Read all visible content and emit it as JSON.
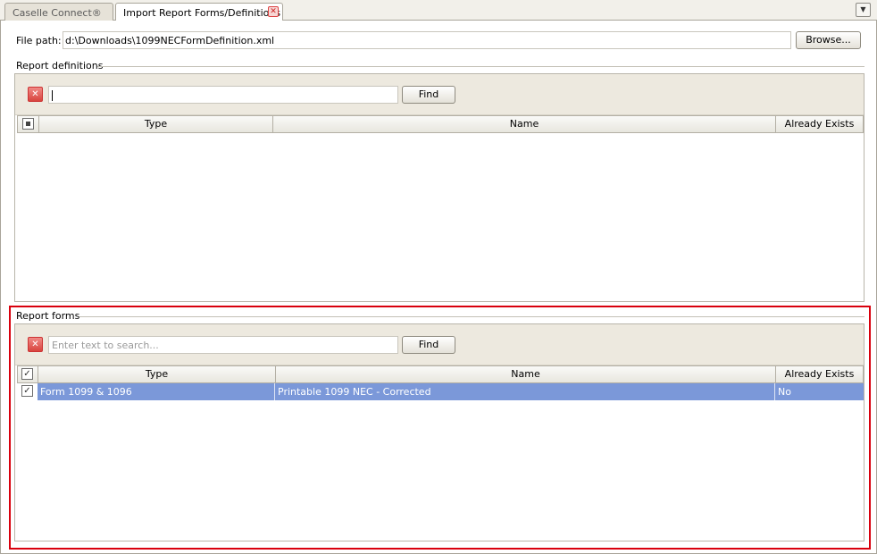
{
  "tabs": [
    {
      "label": "Caselle Connect®"
    },
    {
      "label": "Import Report Forms/Definitions"
    }
  ],
  "file_path": {
    "label": "File path:",
    "value": "d:\\Downloads\\1099NECFormDefinition.xml",
    "browse_label": "Browse..."
  },
  "report_definitions": {
    "title": "Report definitions",
    "search_value": "",
    "find_label": "Find",
    "columns": [
      "Type",
      "Name",
      "Already Exists"
    ],
    "rows": []
  },
  "report_forms": {
    "title": "Report forms",
    "search_placeholder": "Enter text to search...",
    "find_label": "Find",
    "columns": [
      "Type",
      "Name",
      "Already Exists"
    ],
    "rows": [
      {
        "checked": true,
        "type": "Form 1099 & 1096",
        "name": "Printable 1099 NEC - Corrected",
        "already_exists": "No"
      }
    ]
  },
  "colors": {
    "selected_row": "#7b98d9",
    "highlight_border": "#d9000d"
  }
}
